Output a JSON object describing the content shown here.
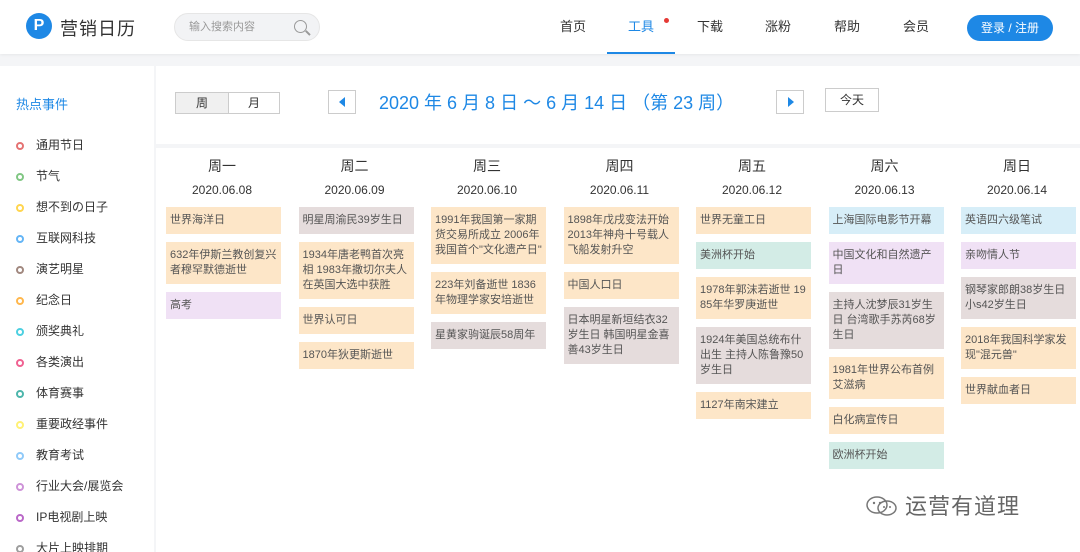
{
  "header": {
    "brand": "营销日历",
    "logo_letter": "P",
    "search_placeholder": "输入搜索内容",
    "nav": [
      "首页",
      "工具",
      "下载",
      "涨粉",
      "帮助",
      "会员"
    ],
    "active_nav": "工具",
    "login": "登录 / 注册"
  },
  "sidebar": {
    "title": "热点事件",
    "items": [
      {
        "label": "通用节日",
        "color": "#e57373"
      },
      {
        "label": "节气",
        "color": "#81c784"
      },
      {
        "label": "想不到の日子",
        "color": "#ffd54f"
      },
      {
        "label": "互联网科技",
        "color": "#64b5f6"
      },
      {
        "label": "演艺明星",
        "color": "#a1887f"
      },
      {
        "label": "纪念日",
        "color": "#ffb74d"
      },
      {
        "label": "颁奖典礼",
        "color": "#4dd0e1"
      },
      {
        "label": "各类演出",
        "color": "#f06292"
      },
      {
        "label": "体育赛事",
        "color": "#4db6ac"
      },
      {
        "label": "重要政经事件",
        "color": "#fff176"
      },
      {
        "label": "教育考试",
        "color": "#90caf9"
      },
      {
        "label": "行业大会/展览会",
        "color": "#ce93d8"
      },
      {
        "label": "IP电视剧上映",
        "color": "#ba68c8"
      },
      {
        "label": "大片上映排期",
        "color": "#9e9e9e"
      }
    ]
  },
  "controls": {
    "week_label": "周",
    "month_label": "月",
    "range_title": "2020 年 6 月 8 日 ～ 6 月 14 日 （第 23 周）",
    "today_label": "今天"
  },
  "calendar": {
    "days": [
      {
        "name": "周一",
        "date": "2020.06.08",
        "events": [
          {
            "text": "世界海洋日",
            "color": "#fde6c8"
          },
          {
            "text": "632年伊斯兰教创复兴者穆罕默德逝世",
            "color": "#fde6c8"
          },
          {
            "text": "高考",
            "color": "#f0e1f5"
          }
        ]
      },
      {
        "name": "周二",
        "date": "2020.06.09",
        "events": [
          {
            "text": "明星周渝民39岁生日",
            "color": "#e5dcdc"
          },
          {
            "text": "1934年唐老鸭首次亮相 1983年撒切尔夫人在英国大选中获胜",
            "color": "#fde6c8"
          },
          {
            "text": "世界认可日",
            "color": "#fde6c8"
          },
          {
            "text": "1870年狄更斯逝世",
            "color": "#fde6c8"
          }
        ]
      },
      {
        "name": "周三",
        "date": "2020.06.10",
        "events": [
          {
            "text": "1991年我国第一家期货交易所成立 2006年我国首个\"文化遗产日\"",
            "color": "#fde6c8"
          },
          {
            "text": "223年刘备逝世 1836年物理学家安培逝世",
            "color": "#fde6c8"
          },
          {
            "text": "星黄家驹诞辰58周年",
            "color": "#e5dcdc"
          }
        ]
      },
      {
        "name": "周四",
        "date": "2020.06.11",
        "events": [
          {
            "text": "1898年戊戌变法开始 2013年神舟十号载人飞船发射升空",
            "color": "#fde6c8"
          },
          {
            "text": "中国人口日",
            "color": "#fde6c8"
          },
          {
            "text": "日本明星新垣结衣32岁生日 韩国明星金喜善43岁生日",
            "color": "#e5dcdc"
          }
        ]
      },
      {
        "name": "周五",
        "date": "2020.06.12",
        "events": [
          {
            "text": "世界无童工日",
            "color": "#fde6c8"
          },
          {
            "text": "美洲杯开始",
            "color": "#d3ece6"
          },
          {
            "text": "1978年郭沫若逝世 1985年华罗庚逝世",
            "color": "#fde6c8"
          },
          {
            "text": "1924年美国总统布什出生 主持人陈鲁豫50岁生日",
            "color": "#e5dcdc"
          },
          {
            "text": "1127年南宋建立",
            "color": "#fde6c8"
          }
        ]
      },
      {
        "name": "周六",
        "date": "2020.06.13",
        "events": [
          {
            "text": "上海国际电影节开幕",
            "color": "#d7eef8"
          },
          {
            "text": "中国文化和自然遗产日",
            "color": "#f0e1f5"
          },
          {
            "text": "主持人沈梦辰31岁生日 台湾歌手苏芮68岁生日",
            "color": "#e5dcdc"
          },
          {
            "text": "1981年世界公布首例艾滋病",
            "color": "#fde6c8"
          },
          {
            "text": "白化病宣传日",
            "color": "#fde6c8"
          },
          {
            "text": "欧洲杯开始",
            "color": "#d3ece6"
          }
        ]
      },
      {
        "name": "周日",
        "date": "2020.06.14",
        "events": [
          {
            "text": "英语四六级笔试",
            "color": "#d7eef8"
          },
          {
            "text": "亲吻情人节",
            "color": "#f0e1f5"
          },
          {
            "text": "钢琴家郎朗38岁生日 小s42岁生日",
            "color": "#e5dcdc"
          },
          {
            "text": "2018年我国科学家发现\"混元兽\"",
            "color": "#fde6c8"
          },
          {
            "text": "世界献血者日",
            "color": "#fde6c8"
          }
        ]
      }
    ]
  },
  "watermark": "运营有道理"
}
